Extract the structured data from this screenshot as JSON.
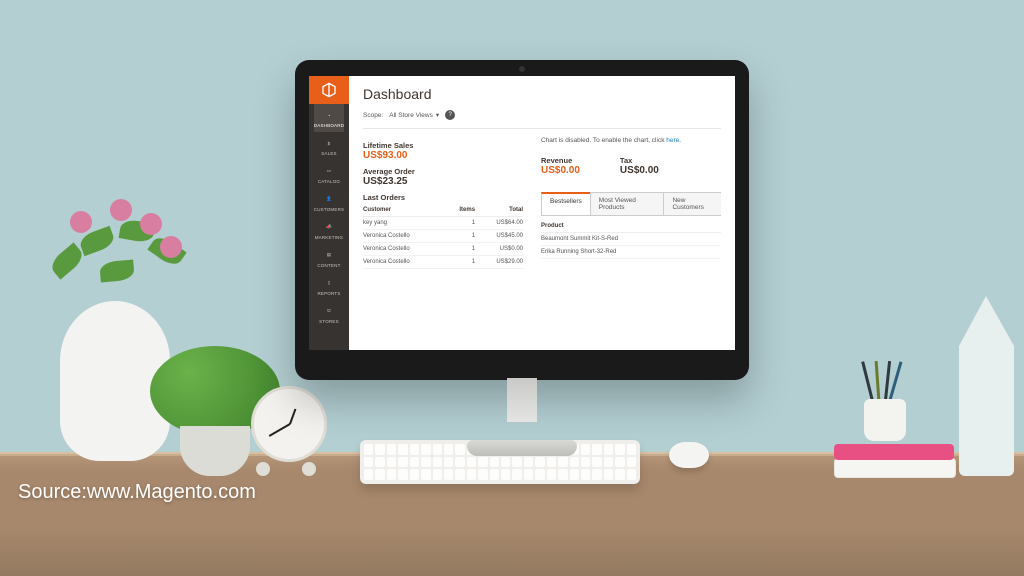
{
  "source_caption": "Source:www.Magento.com",
  "sidebar": {
    "items": [
      {
        "label": "DASHBOARD",
        "active": true
      },
      {
        "label": "SALES"
      },
      {
        "label": "CATALOG"
      },
      {
        "label": "CUSTOMERS"
      },
      {
        "label": "MARKETING"
      },
      {
        "label": "CONTENT"
      },
      {
        "label": "REPORTS"
      },
      {
        "label": "STORES"
      }
    ]
  },
  "header": {
    "title": "Dashboard",
    "scope_label": "Scope:",
    "scope_value": "All Store Views",
    "help_glyph": "?"
  },
  "stats": {
    "lifetime_label": "Lifetime Sales",
    "lifetime_value": "US$93.00",
    "avg_label": "Average Order",
    "avg_value": "US$23.25"
  },
  "last_orders": {
    "heading": "Last Orders",
    "columns": [
      "Customer",
      "Items",
      "Total"
    ],
    "rows": [
      {
        "customer": "key yang",
        "items": "1",
        "total": "US$64.00"
      },
      {
        "customer": "Veronica Costello",
        "items": "1",
        "total": "US$45.00"
      },
      {
        "customer": "Veronica Costello",
        "items": "1",
        "total": "US$0.00"
      },
      {
        "customer": "Veronica Costello",
        "items": "1",
        "total": "US$29.00"
      }
    ]
  },
  "chart": {
    "disabled_msg_pre": "Chart is disabled. To enable the chart, click ",
    "disabled_msg_link": "here",
    "disabled_msg_post": ".",
    "metrics": [
      {
        "label": "Revenue",
        "value": "US$0.00",
        "accent": true
      },
      {
        "label": "Tax",
        "value": "US$0.00",
        "accent": false
      }
    ]
  },
  "tabs": {
    "items": [
      "Bestsellers",
      "Most Viewed Products",
      "New Customers"
    ],
    "active": 0,
    "table": {
      "columns": [
        "Product"
      ],
      "rows": [
        {
          "product": "Beaumont Summit Kit-S-Red"
        },
        {
          "product": "Erika Running Short-32-Red"
        }
      ]
    }
  },
  "colors": {
    "accent": "#e85f1a",
    "sidebar": "#373330"
  }
}
